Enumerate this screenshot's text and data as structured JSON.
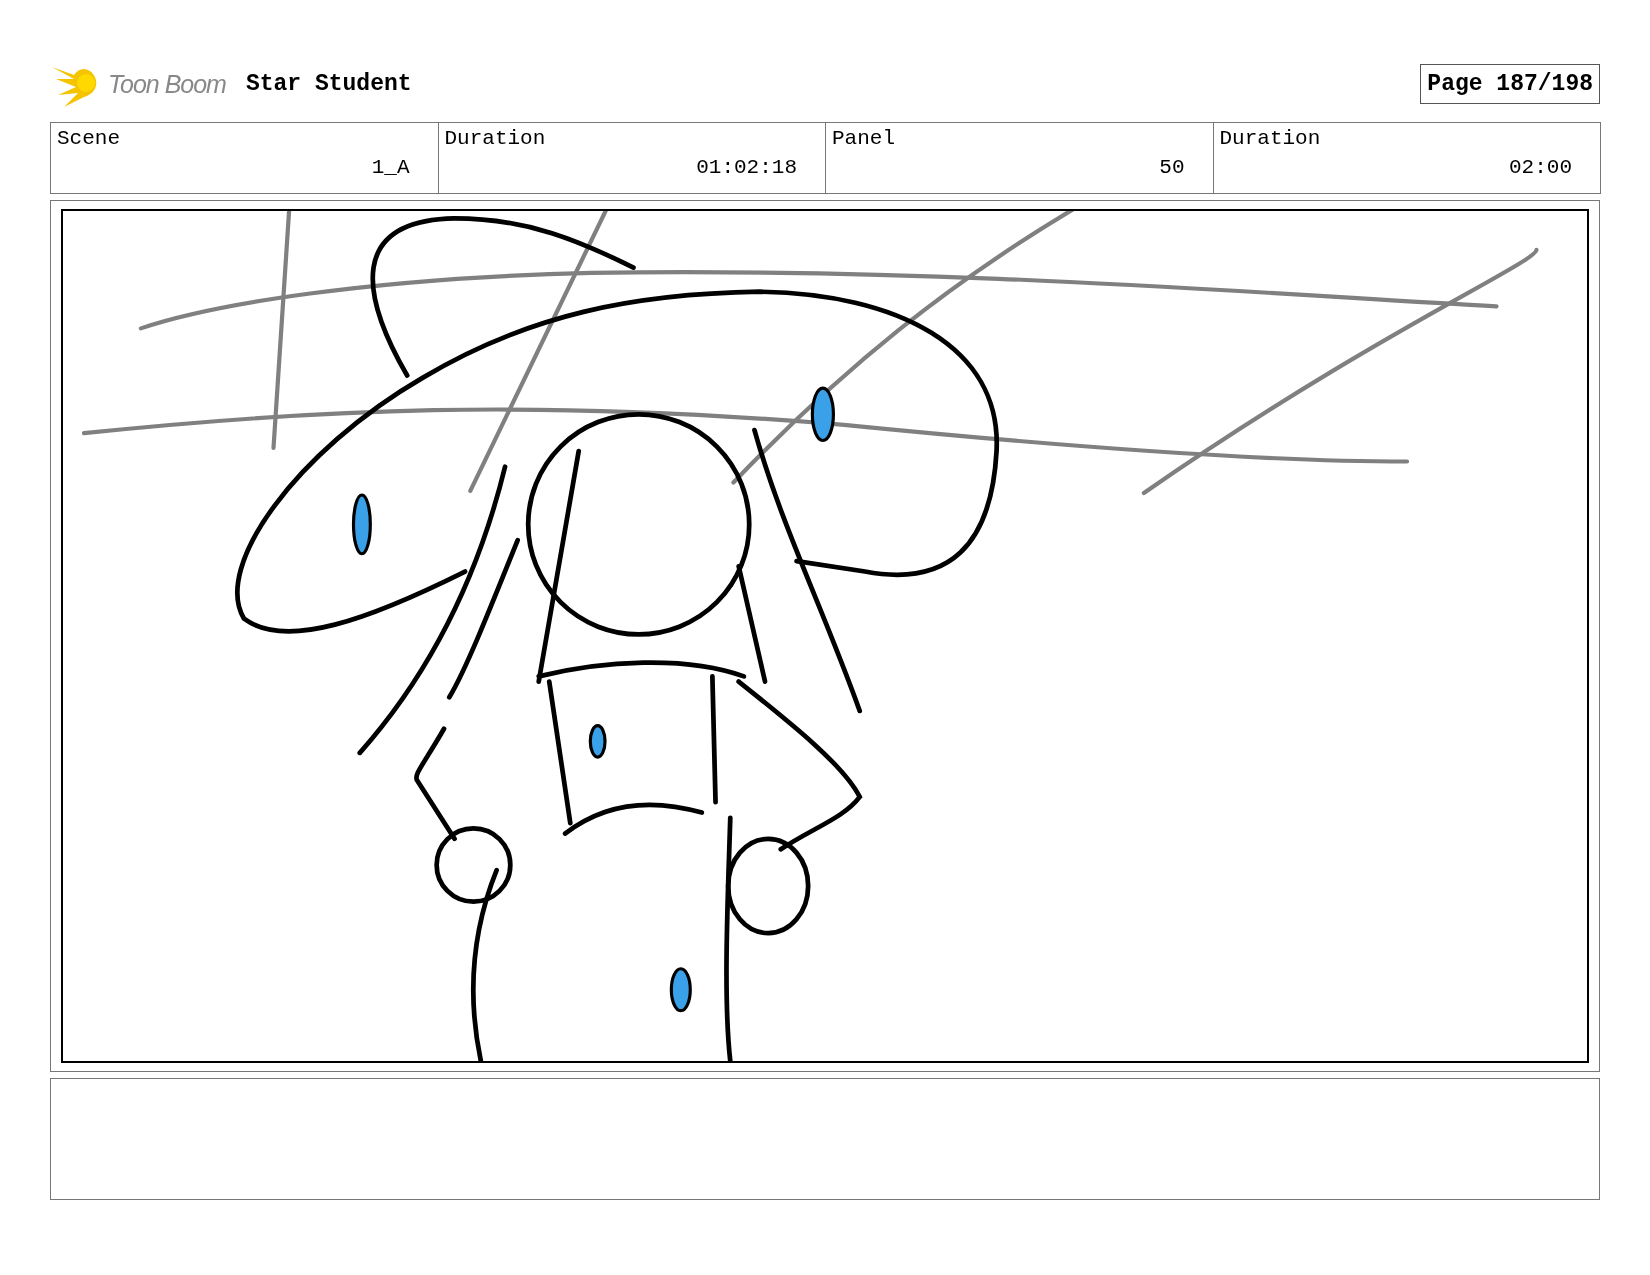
{
  "header": {
    "logo_text": "Toon Boom",
    "title": "Star Student",
    "page": "Page 187/198"
  },
  "info": [
    {
      "label": "Scene",
      "value": "1_A"
    },
    {
      "label": "Duration",
      "value": "01:02:18"
    },
    {
      "label": "Panel",
      "value": "50"
    },
    {
      "label": "Duration",
      "value": "02:00"
    }
  ]
}
